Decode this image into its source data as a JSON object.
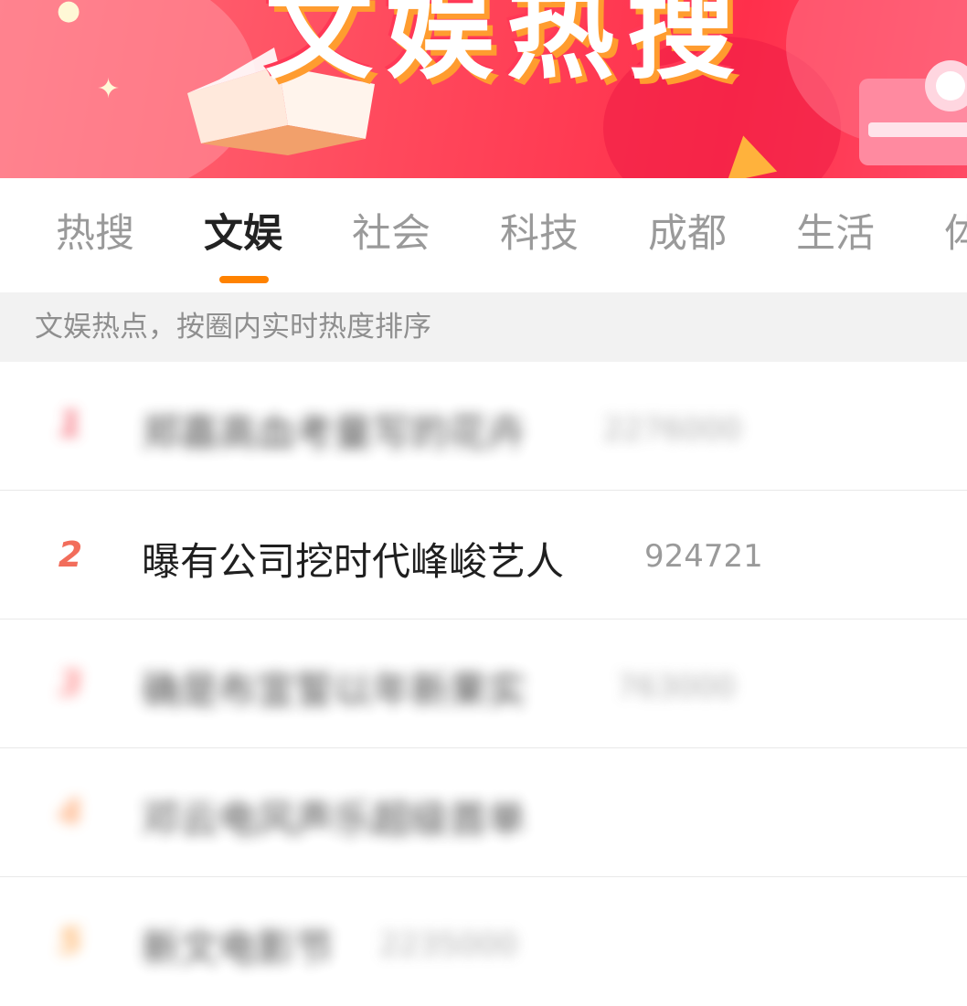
{
  "banner": {
    "title": "文娱热搜"
  },
  "tabs": [
    {
      "label": "热搜"
    },
    {
      "label": "文娱"
    },
    {
      "label": "社会"
    },
    {
      "label": "科技"
    },
    {
      "label": "成都"
    },
    {
      "label": "生活"
    },
    {
      "label": "体"
    }
  ],
  "active_tab": "文娱",
  "subtitle": "文娱热点，按圈内实时热度排序",
  "list": {
    "items": [
      {
        "rank": "1",
        "title": "郑嘉高血考量写的花卉",
        "heat": "2276000",
        "blurred": true,
        "rank_color": "#f4515f"
      },
      {
        "rank": "2",
        "title": "曝有公司挖时代峰峻艺人",
        "heat": "924721",
        "blurred": false,
        "rank_color": "#f26d5b"
      },
      {
        "rank": "3",
        "title": "确是布宣誓以年新果实",
        "heat": "763000",
        "blurred": true,
        "rank_color": "#ff7e7e"
      },
      {
        "rank": "4",
        "title": "邓云电风声乐超级首单",
        "heat": "",
        "blurred": true,
        "rank_color": "#ffa36b"
      },
      {
        "rank": "5",
        "title": "新文电影节",
        "heat": "2235000",
        "blurred": true,
        "rank_color": "#ffaa55"
      }
    ]
  },
  "colors": {
    "accent": "#ff8200",
    "banner_red": "#ff3b52"
  }
}
